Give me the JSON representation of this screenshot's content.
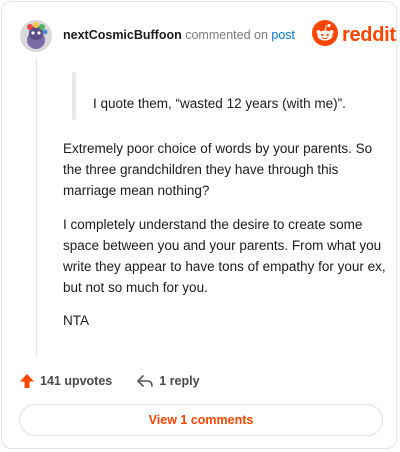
{
  "header": {
    "username": "nextCosmicBuffoon",
    "commented_on": "commented on",
    "post_link": "post"
  },
  "brand": {
    "name": "reddit",
    "color": "#ff4500",
    "icon": "reddit-logo-icon"
  },
  "avatar": {
    "icon": "snoo-avatar-icon"
  },
  "comment": {
    "quote": "I quote them, “wasted 12 years (with me)”.",
    "paragraphs": [
      "Extremely poor choice of words by your parents. So the three grandchildren they have through this marriage mean nothing?",
      "I completely understand the desire to create some space between you and your parents. From what you write they appear to have tons of empathy for your ex, but not so much for you.",
      "NTA"
    ]
  },
  "actions": {
    "upvotes": "141 upvotes",
    "upvote_icon": "upvote-arrow-icon",
    "reply": "1 reply",
    "reply_icon": "reply-arrow-icon"
  },
  "footer": {
    "view_comments": "View 1 comments"
  }
}
